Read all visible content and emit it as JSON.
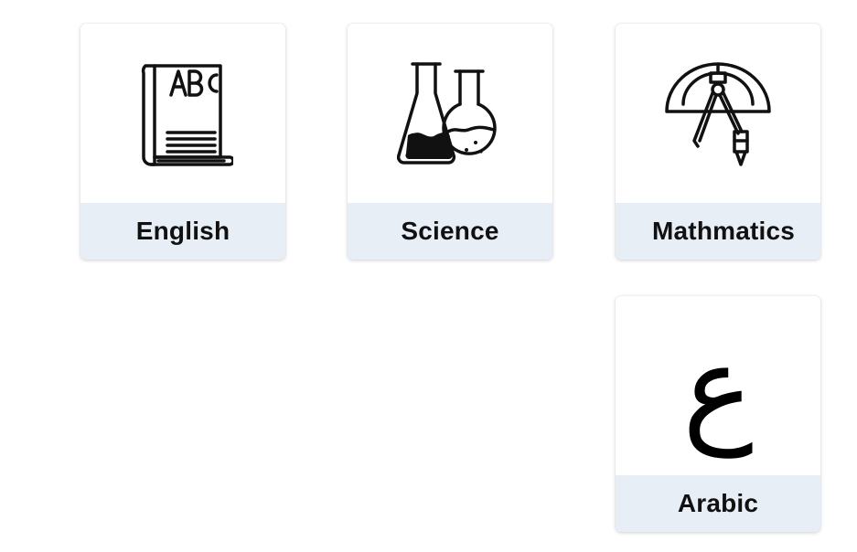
{
  "subjects": [
    {
      "label": "English",
      "icon": "abc-book-icon"
    },
    {
      "label": "Science",
      "icon": "flasks-icon"
    },
    {
      "label": "Mathmatics",
      "icon": "protractor-compass-icon"
    },
    {
      "label": "Arabic",
      "icon": "arabic-letter-ain-icon",
      "glyph": "ع"
    }
  ],
  "colors": {
    "card_background": "#ffffff",
    "label_background": "#e7eef6",
    "label_text": "#111111",
    "icon_stroke": "#111111"
  }
}
